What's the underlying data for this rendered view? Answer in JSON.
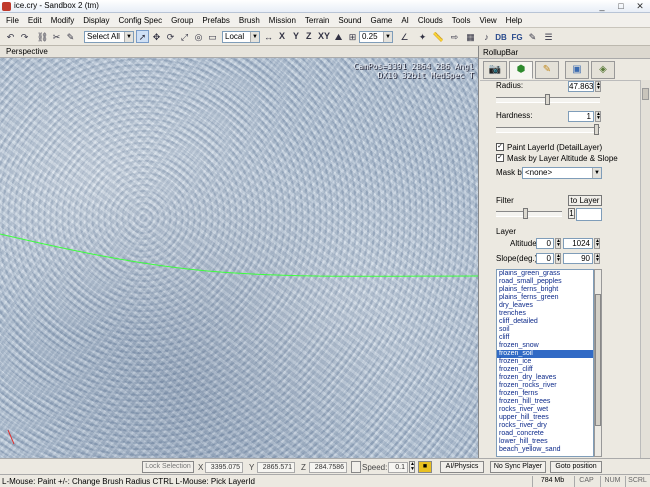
{
  "window": {
    "title": "ice.cry - Sandbox 2 (tm)",
    "controls": [
      "_",
      "□",
      "✕"
    ]
  },
  "menu": [
    "File",
    "Edit",
    "Modify",
    "Display",
    "Config Spec",
    "Group",
    "Prefabs",
    "Brush",
    "Mission",
    "Terrain",
    "Sound",
    "Game",
    "AI",
    "Clouds",
    "Tools",
    "View",
    "Help"
  ],
  "toolbar": {
    "select_value": "Select All",
    "coord_value": "Local",
    "axes": [
      "X",
      "Y",
      "Z",
      "XY"
    ],
    "grid_value": "0.25",
    "right_items": [
      "DB",
      "FG"
    ]
  },
  "viewport": {
    "label": "Perspective",
    "campos_line1": "CamPos=3391 2864 286 Angl",
    "campos_line2": "DX10 32bit MedSpec T"
  },
  "rollup": {
    "title": "RollupBar",
    "radius_label": "Radius:",
    "radius_value": "47.863",
    "radius_level": 0.5,
    "hardness_label": "Hardness:",
    "hardness_value": "1",
    "hardness_level": 1.0,
    "paint_layer_label": "Paint LayerId (DetailLayer)",
    "mask_label": "Mask by Layer Altitude & Slope",
    "mask_by_label": "Mask by",
    "mask_by_value": "<none>",
    "filter_label": "Filter",
    "to_layer_label": "to Layer",
    "filter_level": 0.45,
    "filter_value": "1",
    "layer_label": "Layer",
    "altitude_label": "Altitude",
    "altitude_min": "0",
    "altitude_max": "1024",
    "slope_label": "Slope(deg.)",
    "slope_min": "0",
    "slope_max": "90",
    "layers": [
      "plains_green_grass",
      "road_small_pepples",
      "plains_ferns_bright",
      "plains_ferns_green",
      "dry_leaves",
      "trenches",
      "cliff_detailed",
      "soil",
      "cliff",
      "frozen_snow",
      "frozen_soil",
      "frozen_ice",
      "frozen_cliff",
      "frozen_dry_leaves",
      "frozen_rocks_river",
      "frozen_ferns",
      "frozen_hill_trees",
      "rocks_river_wet",
      "upper_hill_trees",
      "rocks_river_dry",
      "road_concrete",
      "lower_hill_trees",
      "beach_yellow_sand"
    ],
    "selected_layer": "frozen_soil"
  },
  "infobar": {
    "lock_selection": "Lock Selection",
    "x_label": "X",
    "x_value": "3395.075",
    "y_label": "Y",
    "y_value": "2865.571",
    "z_label": "Z",
    "z_value": "284.7586",
    "speed_label": "Speed:",
    "speed_value": "0.1",
    "ai_physics": "AI/Physics",
    "no_sync": "No Sync Player",
    "goto": "Goto position"
  },
  "status": {
    "message": "L-Mouse: Paint   +/-: Change Brush Radius   CTRL L-Mouse: Pick LayerId",
    "memory": "784 Mb",
    "cap": "CAP",
    "num": "NUM",
    "scrl": "SCRL"
  },
  "colors": {
    "selection": "#316ac5",
    "brush_line": "#3cff3c",
    "list_text": "#0d2a8a"
  }
}
